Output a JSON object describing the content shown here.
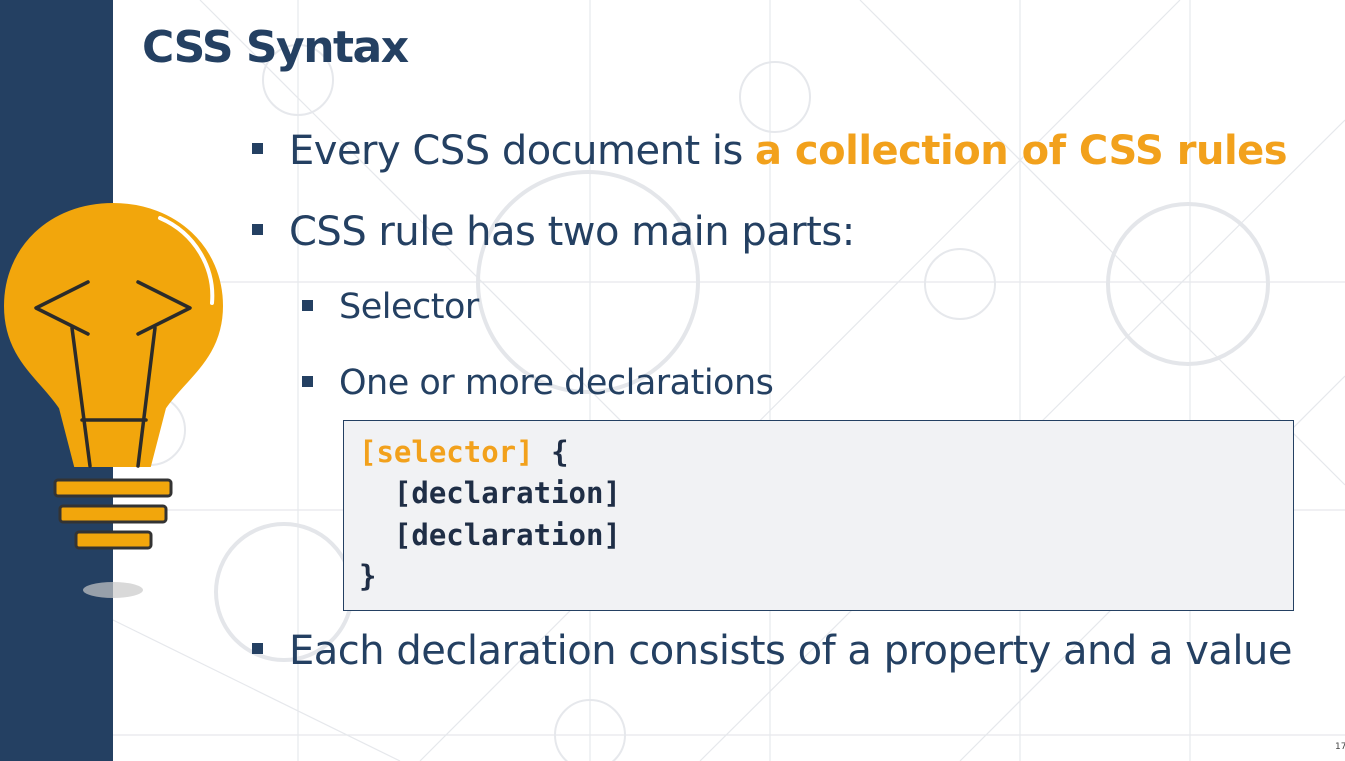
{
  "slide": {
    "title": "CSS Syntax",
    "bullets": {
      "b1_prefix": "Every CSS document is ",
      "b1_highlight": "a collection of CSS rules",
      "b2": "CSS rule has two main parts:",
      "b2_sub1": "Selector",
      "b2_sub2": "One or more declarations",
      "b3": "Each declaration consists of a property and a value"
    },
    "code": {
      "line1_selector": "[selector]",
      "line1_brace": " {",
      "line2": "  [declaration]",
      "line3": "  [declaration]",
      "line4": "}"
    },
    "page_number": "17"
  },
  "icons": {
    "bulb": "lightbulb-code-icon",
    "bullet": "square-bullet-icon"
  },
  "colors": {
    "navy": "#244062",
    "orange": "#f2a11c",
    "code_bg": "#f1f2f4"
  }
}
